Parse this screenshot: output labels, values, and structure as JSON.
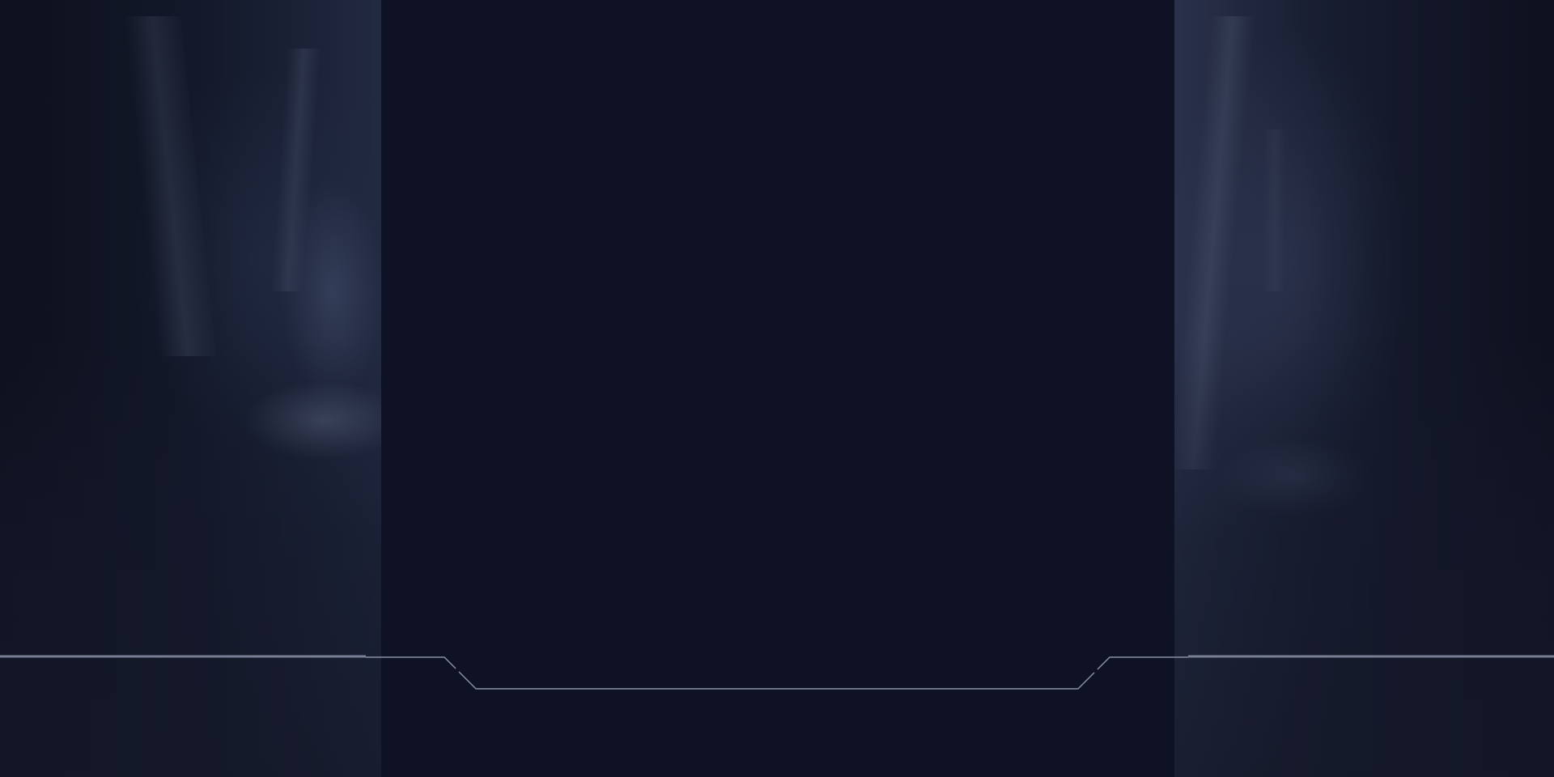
{
  "colors": {
    "background": "#0f1224",
    "side_panel_tint": "#1c2238",
    "frame_line": "#8a8fa6",
    "frame_line_bright": "#9aa0b8"
  }
}
